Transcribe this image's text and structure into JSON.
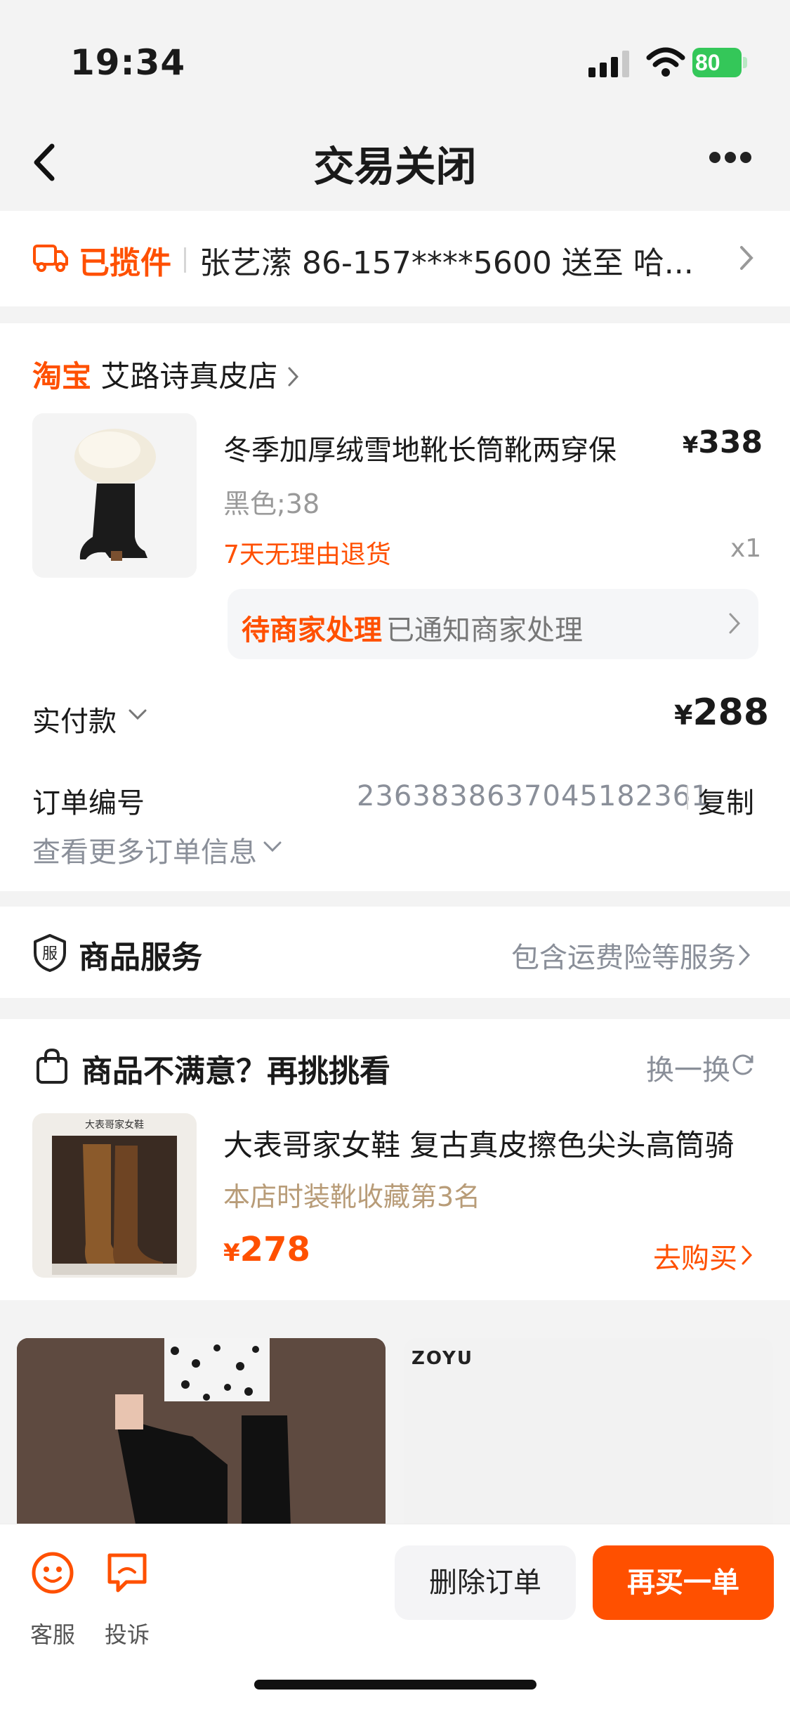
{
  "status_bar": {
    "time": "19:34",
    "battery": "80"
  },
  "header": {
    "title": "交易关闭"
  },
  "logistics": {
    "status": "已揽件",
    "detail": "张艺潆 86-157****5600 送至 哈..."
  },
  "order": {
    "shop_brand": "淘宝",
    "shop_name": "艾路诗真皮店",
    "product": {
      "title": "冬季加厚绒雪地靴长筒靴两穿保",
      "price_symbol": "¥",
      "price": "338",
      "spec": "黑色;38",
      "quantity": "x1",
      "return_policy": "7天无理由退货"
    },
    "merchant_status": "待商家处理",
    "merchant_note": "已通知商家处理",
    "paid_label": "实付款",
    "paid_symbol": "¥",
    "paid_amount": "288",
    "order_no_label": "订单编号",
    "order_no": "2363838637045182361",
    "copy_label": "复制",
    "more_info_label": "查看更多订单信息"
  },
  "service": {
    "title": "商品服务",
    "desc": "包含运费险等服务"
  },
  "recommend": {
    "title": "商品不满意？再挑挑看",
    "refresh_label": "换一换",
    "item": {
      "thumb_text": "大表哥家女鞋",
      "name": "大表哥家女鞋 复古真皮擦色尖头高筒骑",
      "rank": "本店时装靴收藏第3名",
      "price_symbol": "¥",
      "price": "278",
      "buy_label": "去购买"
    }
  },
  "feed": {
    "right_brand": "ZOYU"
  },
  "bottom_bar": {
    "customer_service": "客服",
    "complain": "投诉",
    "delete_label": "删除订单",
    "rebuy_label": "再买一单"
  },
  "colors": {
    "accent": "#ff5000",
    "muted": "#8a8f99",
    "background": "#f3f3f3"
  },
  "icons": [
    "back-icon",
    "more-icon",
    "truck-icon",
    "chevron-right-icon",
    "chevron-down-icon",
    "shield-service-icon",
    "shopping-bag-icon",
    "refresh-icon",
    "customer-service-icon",
    "complain-icon"
  ]
}
